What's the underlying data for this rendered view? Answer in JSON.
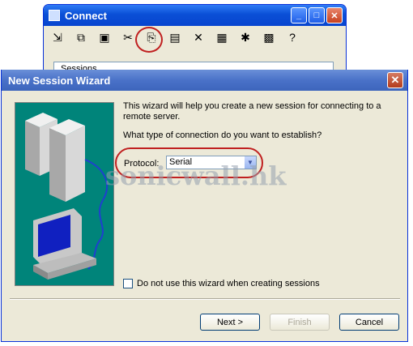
{
  "connect_window": {
    "title": "Connect",
    "tree_item": "Sessions"
  },
  "wizard": {
    "title": "New Session Wizard",
    "intro": "This wizard will help you create a new session for connecting to a remote server.",
    "question": "What type of connection do you want to establish?",
    "protocol_label": "Protocol:",
    "protocol_value": "Serial",
    "checkbox_label": "Do not use this wizard when creating sessions",
    "checkbox_checked": false,
    "buttons": {
      "next": "Next >",
      "finish": "Finish",
      "cancel": "Cancel"
    }
  },
  "watermark": "sonicwall.hk",
  "colors": {
    "highlight_circle": "#c02020",
    "illustration_bg": "#00847a"
  }
}
